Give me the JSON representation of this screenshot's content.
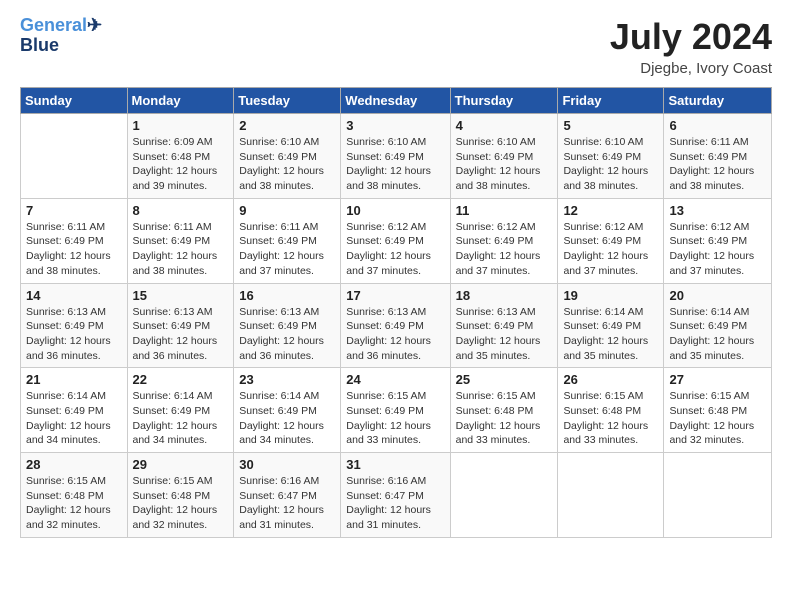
{
  "logo": {
    "line1": "General",
    "line2": "Blue"
  },
  "header": {
    "month": "July 2024",
    "location": "Djegbe, Ivory Coast"
  },
  "weekdays": [
    "Sunday",
    "Monday",
    "Tuesday",
    "Wednesday",
    "Thursday",
    "Friday",
    "Saturday"
  ],
  "weeks": [
    [
      {
        "day": "",
        "info": ""
      },
      {
        "day": "1",
        "info": "Sunrise: 6:09 AM\nSunset: 6:48 PM\nDaylight: 12 hours\nand 39 minutes."
      },
      {
        "day": "2",
        "info": "Sunrise: 6:10 AM\nSunset: 6:49 PM\nDaylight: 12 hours\nand 38 minutes."
      },
      {
        "day": "3",
        "info": "Sunrise: 6:10 AM\nSunset: 6:49 PM\nDaylight: 12 hours\nand 38 minutes."
      },
      {
        "day": "4",
        "info": "Sunrise: 6:10 AM\nSunset: 6:49 PM\nDaylight: 12 hours\nand 38 minutes."
      },
      {
        "day": "5",
        "info": "Sunrise: 6:10 AM\nSunset: 6:49 PM\nDaylight: 12 hours\nand 38 minutes."
      },
      {
        "day": "6",
        "info": "Sunrise: 6:11 AM\nSunset: 6:49 PM\nDaylight: 12 hours\nand 38 minutes."
      }
    ],
    [
      {
        "day": "7",
        "info": "Sunrise: 6:11 AM\nSunset: 6:49 PM\nDaylight: 12 hours\nand 38 minutes."
      },
      {
        "day": "8",
        "info": "Sunrise: 6:11 AM\nSunset: 6:49 PM\nDaylight: 12 hours\nand 38 minutes."
      },
      {
        "day": "9",
        "info": "Sunrise: 6:11 AM\nSunset: 6:49 PM\nDaylight: 12 hours\nand 37 minutes."
      },
      {
        "day": "10",
        "info": "Sunrise: 6:12 AM\nSunset: 6:49 PM\nDaylight: 12 hours\nand 37 minutes."
      },
      {
        "day": "11",
        "info": "Sunrise: 6:12 AM\nSunset: 6:49 PM\nDaylight: 12 hours\nand 37 minutes."
      },
      {
        "day": "12",
        "info": "Sunrise: 6:12 AM\nSunset: 6:49 PM\nDaylight: 12 hours\nand 37 minutes."
      },
      {
        "day": "13",
        "info": "Sunrise: 6:12 AM\nSunset: 6:49 PM\nDaylight: 12 hours\nand 37 minutes."
      }
    ],
    [
      {
        "day": "14",
        "info": "Sunrise: 6:13 AM\nSunset: 6:49 PM\nDaylight: 12 hours\nand 36 minutes."
      },
      {
        "day": "15",
        "info": "Sunrise: 6:13 AM\nSunset: 6:49 PM\nDaylight: 12 hours\nand 36 minutes."
      },
      {
        "day": "16",
        "info": "Sunrise: 6:13 AM\nSunset: 6:49 PM\nDaylight: 12 hours\nand 36 minutes."
      },
      {
        "day": "17",
        "info": "Sunrise: 6:13 AM\nSunset: 6:49 PM\nDaylight: 12 hours\nand 36 minutes."
      },
      {
        "day": "18",
        "info": "Sunrise: 6:13 AM\nSunset: 6:49 PM\nDaylight: 12 hours\nand 35 minutes."
      },
      {
        "day": "19",
        "info": "Sunrise: 6:14 AM\nSunset: 6:49 PM\nDaylight: 12 hours\nand 35 minutes."
      },
      {
        "day": "20",
        "info": "Sunrise: 6:14 AM\nSunset: 6:49 PM\nDaylight: 12 hours\nand 35 minutes."
      }
    ],
    [
      {
        "day": "21",
        "info": "Sunrise: 6:14 AM\nSunset: 6:49 PM\nDaylight: 12 hours\nand 34 minutes."
      },
      {
        "day": "22",
        "info": "Sunrise: 6:14 AM\nSunset: 6:49 PM\nDaylight: 12 hours\nand 34 minutes."
      },
      {
        "day": "23",
        "info": "Sunrise: 6:14 AM\nSunset: 6:49 PM\nDaylight: 12 hours\nand 34 minutes."
      },
      {
        "day": "24",
        "info": "Sunrise: 6:15 AM\nSunset: 6:49 PM\nDaylight: 12 hours\nand 33 minutes."
      },
      {
        "day": "25",
        "info": "Sunrise: 6:15 AM\nSunset: 6:48 PM\nDaylight: 12 hours\nand 33 minutes."
      },
      {
        "day": "26",
        "info": "Sunrise: 6:15 AM\nSunset: 6:48 PM\nDaylight: 12 hours\nand 33 minutes."
      },
      {
        "day": "27",
        "info": "Sunrise: 6:15 AM\nSunset: 6:48 PM\nDaylight: 12 hours\nand 32 minutes."
      }
    ],
    [
      {
        "day": "28",
        "info": "Sunrise: 6:15 AM\nSunset: 6:48 PM\nDaylight: 12 hours\nand 32 minutes."
      },
      {
        "day": "29",
        "info": "Sunrise: 6:15 AM\nSunset: 6:48 PM\nDaylight: 12 hours\nand 32 minutes."
      },
      {
        "day": "30",
        "info": "Sunrise: 6:16 AM\nSunset: 6:47 PM\nDaylight: 12 hours\nand 31 minutes."
      },
      {
        "day": "31",
        "info": "Sunrise: 6:16 AM\nSunset: 6:47 PM\nDaylight: 12 hours\nand 31 minutes."
      },
      {
        "day": "",
        "info": ""
      },
      {
        "day": "",
        "info": ""
      },
      {
        "day": "",
        "info": ""
      }
    ]
  ]
}
